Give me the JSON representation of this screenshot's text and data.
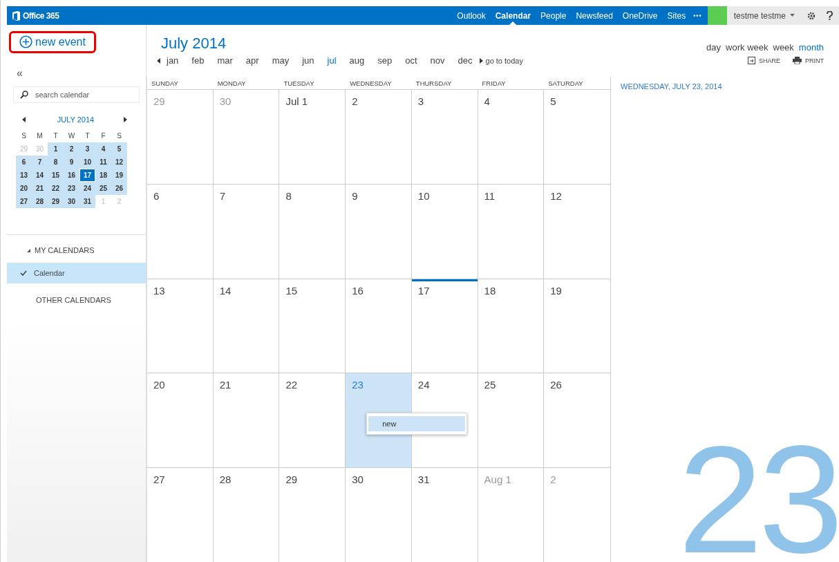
{
  "topbar": {
    "brand": "Office 365",
    "nav": [
      {
        "label": "Outlook",
        "selected": false
      },
      {
        "label": "Calendar",
        "selected": true
      },
      {
        "label": "People",
        "selected": false
      },
      {
        "label": "Newsfeed",
        "selected": false
      },
      {
        "label": "OneDrive",
        "selected": false
      },
      {
        "label": "Sites",
        "selected": false
      }
    ],
    "more": "•••",
    "user": "testme testme"
  },
  "new_event": {
    "label": "new event",
    "highlighted": true
  },
  "header": {
    "title": "July 2014",
    "months": [
      {
        "label": "jan",
        "selected": false
      },
      {
        "label": "feb",
        "selected": false
      },
      {
        "label": "mar",
        "selected": false
      },
      {
        "label": "apr",
        "selected": false
      },
      {
        "label": "may",
        "selected": false
      },
      {
        "label": "jun",
        "selected": false
      },
      {
        "label": "jul",
        "selected": true
      },
      {
        "label": "aug",
        "selected": false
      },
      {
        "label": "sep",
        "selected": false
      },
      {
        "label": "oct",
        "selected": false
      },
      {
        "label": "nov",
        "selected": false
      },
      {
        "label": "dec",
        "selected": false
      }
    ],
    "go_to_today": "go to today",
    "views": [
      {
        "label": "day",
        "selected": false
      },
      {
        "label": "work week",
        "selected": false
      },
      {
        "label": "week",
        "selected": false
      },
      {
        "label": "month",
        "selected": true
      }
    ],
    "actions": [
      {
        "kind": "share",
        "label": "SHARE"
      },
      {
        "kind": "print",
        "label": "PRINT"
      }
    ]
  },
  "sidebar": {
    "collapse": "«",
    "search": {
      "placeholder": "search calendar"
    },
    "mini_calendar": {
      "title": "JULY 2014",
      "weekdays": [
        "S",
        "M",
        "T",
        "W",
        "T",
        "F",
        "S"
      ],
      "weeks": [
        [
          {
            "label": "29",
            "in_month": false,
            "selected": false
          },
          {
            "label": "30",
            "in_month": false,
            "selected": false
          },
          {
            "label": "1",
            "in_month": true,
            "selected": false
          },
          {
            "label": "2",
            "in_month": true,
            "selected": false
          },
          {
            "label": "3",
            "in_month": true,
            "selected": false
          },
          {
            "label": "4",
            "in_month": true,
            "selected": false
          },
          {
            "label": "5",
            "in_month": true,
            "selected": false
          }
        ],
        [
          {
            "label": "6",
            "in_month": true,
            "selected": false
          },
          {
            "label": "7",
            "in_month": true,
            "selected": false
          },
          {
            "label": "8",
            "in_month": true,
            "selected": false
          },
          {
            "label": "9",
            "in_month": true,
            "selected": false
          },
          {
            "label": "10",
            "in_month": true,
            "selected": false
          },
          {
            "label": "11",
            "in_month": true,
            "selected": false
          },
          {
            "label": "12",
            "in_month": true,
            "selected": false
          }
        ],
        [
          {
            "label": "13",
            "in_month": true,
            "selected": false
          },
          {
            "label": "14",
            "in_month": true,
            "selected": false
          },
          {
            "label": "15",
            "in_month": true,
            "selected": false
          },
          {
            "label": "16",
            "in_month": true,
            "selected": false
          },
          {
            "label": "17",
            "in_month": true,
            "selected": true
          },
          {
            "label": "18",
            "in_month": true,
            "selected": false
          },
          {
            "label": "19",
            "in_month": true,
            "selected": false
          }
        ],
        [
          {
            "label": "20",
            "in_month": true,
            "selected": false
          },
          {
            "label": "21",
            "in_month": true,
            "selected": false
          },
          {
            "label": "22",
            "in_month": true,
            "selected": false
          },
          {
            "label": "23",
            "in_month": true,
            "selected": false
          },
          {
            "label": "24",
            "in_month": true,
            "selected": false
          },
          {
            "label": "25",
            "in_month": true,
            "selected": false
          },
          {
            "label": "26",
            "in_month": true,
            "selected": false
          }
        ],
        [
          {
            "label": "27",
            "in_month": true,
            "selected": false
          },
          {
            "label": "28",
            "in_month": true,
            "selected": false
          },
          {
            "label": "29",
            "in_month": true,
            "selected": false
          },
          {
            "label": "30",
            "in_month": true,
            "selected": false
          },
          {
            "label": "31",
            "in_month": true,
            "selected": false
          },
          {
            "label": "1",
            "in_month": false,
            "selected": false
          },
          {
            "label": "2",
            "in_month": false,
            "selected": false
          }
        ]
      ]
    },
    "my_calendars": {
      "label": "MY CALENDARS",
      "expanded": true,
      "items": [
        {
          "label": "Calendar",
          "checked": true,
          "selected": true
        }
      ]
    },
    "other_calendars": {
      "label": "OTHER CALENDARS"
    }
  },
  "grid": {
    "weekdays": [
      "SUNDAY",
      "MONDAY",
      "TUESDAY",
      "WEDNESDAY",
      "THURSDAY",
      "FRIDAY",
      "SATURDAY"
    ],
    "weeks": [
      [
        {
          "label": "29",
          "in_month": false,
          "today": false,
          "selected": false
        },
        {
          "label": "30",
          "in_month": false,
          "today": false,
          "selected": false
        },
        {
          "label": "Jul 1",
          "in_month": true,
          "today": false,
          "selected": false
        },
        {
          "label": "2",
          "in_month": true,
          "today": false,
          "selected": false
        },
        {
          "label": "3",
          "in_month": true,
          "today": false,
          "selected": false
        },
        {
          "label": "4",
          "in_month": true,
          "today": false,
          "selected": false
        },
        {
          "label": "5",
          "in_month": true,
          "today": false,
          "selected": false
        }
      ],
      [
        {
          "label": "6",
          "in_month": true,
          "today": false,
          "selected": false
        },
        {
          "label": "7",
          "in_month": true,
          "today": false,
          "selected": false
        },
        {
          "label": "8",
          "in_month": true,
          "today": false,
          "selected": false
        },
        {
          "label": "9",
          "in_month": true,
          "today": false,
          "selected": false
        },
        {
          "label": "10",
          "in_month": true,
          "today": false,
          "selected": false
        },
        {
          "label": "11",
          "in_month": true,
          "today": false,
          "selected": false
        },
        {
          "label": "12",
          "in_month": true,
          "today": false,
          "selected": false
        }
      ],
      [
        {
          "label": "13",
          "in_month": true,
          "today": false,
          "selected": false
        },
        {
          "label": "14",
          "in_month": true,
          "today": false,
          "selected": false
        },
        {
          "label": "15",
          "in_month": true,
          "today": false,
          "selected": false
        },
        {
          "label": "16",
          "in_month": true,
          "today": false,
          "selected": false
        },
        {
          "label": "17",
          "in_month": true,
          "today": true,
          "selected": false
        },
        {
          "label": "18",
          "in_month": true,
          "today": false,
          "selected": false
        },
        {
          "label": "19",
          "in_month": true,
          "today": false,
          "selected": false
        }
      ],
      [
        {
          "label": "20",
          "in_month": true,
          "today": false,
          "selected": false
        },
        {
          "label": "21",
          "in_month": true,
          "today": false,
          "selected": false
        },
        {
          "label": "22",
          "in_month": true,
          "today": false,
          "selected": false
        },
        {
          "label": "23",
          "in_month": true,
          "today": false,
          "selected": true
        },
        {
          "label": "24",
          "in_month": true,
          "today": false,
          "selected": false
        },
        {
          "label": "25",
          "in_month": true,
          "today": false,
          "selected": false
        },
        {
          "label": "26",
          "in_month": true,
          "today": false,
          "selected": false
        }
      ],
      [
        {
          "label": "27",
          "in_month": true,
          "today": false,
          "selected": false
        },
        {
          "label": "28",
          "in_month": true,
          "today": false,
          "selected": false
        },
        {
          "label": "29",
          "in_month": true,
          "today": false,
          "selected": false
        },
        {
          "label": "30",
          "in_month": true,
          "today": false,
          "selected": false
        },
        {
          "label": "31",
          "in_month": true,
          "today": false,
          "selected": false
        },
        {
          "label": "Aug 1",
          "in_month": false,
          "today": false,
          "selected": false
        },
        {
          "label": "2",
          "in_month": false,
          "today": false,
          "selected": false
        }
      ]
    ]
  },
  "context_menu": {
    "items": [
      {
        "label": "new",
        "selected": true
      }
    ]
  },
  "day_pane": {
    "heading": "WEDNESDAY, JULY 23, 2014",
    "big_day": "23"
  }
}
